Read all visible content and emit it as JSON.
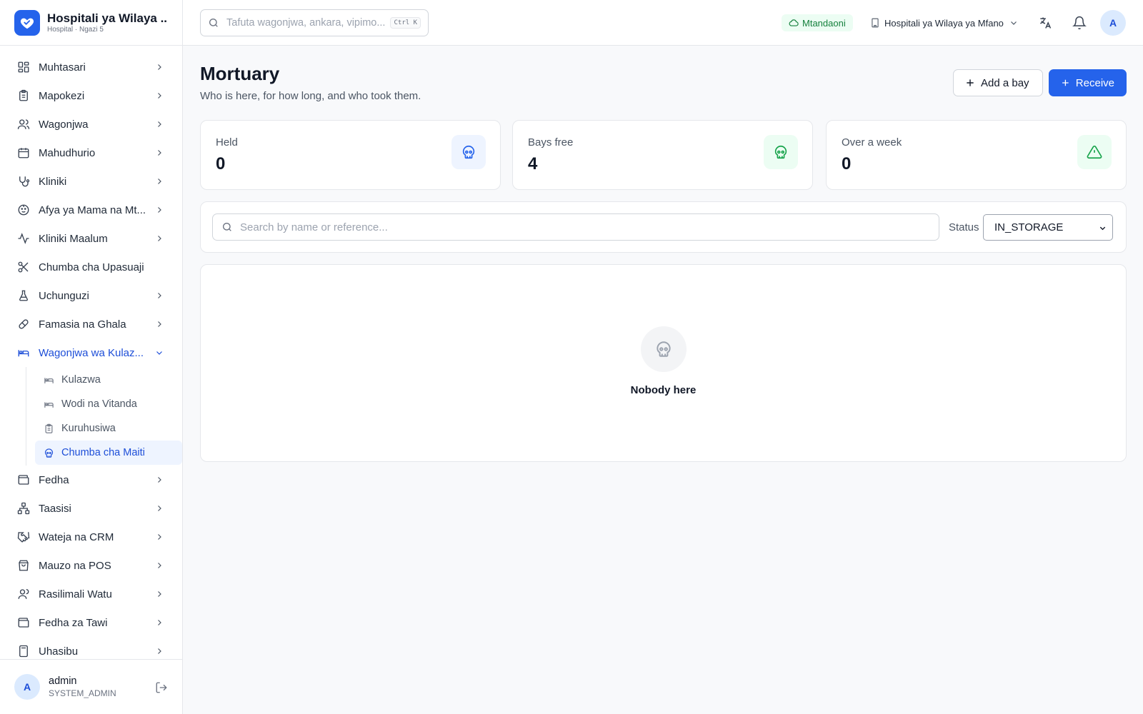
{
  "brand": {
    "name": "Hospitali ya Wilaya ...",
    "subtitle": "Hospital · Ngazi 5"
  },
  "sidebar": {
    "items": [
      {
        "label": "Muhtasari",
        "icon": "grid-icon"
      },
      {
        "label": "Mapokezi",
        "icon": "clipboard-icon"
      },
      {
        "label": "Wagonjwa",
        "icon": "users-icon"
      },
      {
        "label": "Mahudhurio",
        "icon": "calendar-icon"
      },
      {
        "label": "Kliniki",
        "icon": "stethoscope-icon"
      },
      {
        "label": "Afya ya Mama na Mt...",
        "icon": "baby-icon"
      },
      {
        "label": "Kliniki Maalum",
        "icon": "activity-icon"
      },
      {
        "label": "Chumba cha Upasuaji",
        "icon": "scissors-icon"
      },
      {
        "label": "Uchunguzi",
        "icon": "flask-icon"
      },
      {
        "label": "Famasia na Ghala",
        "icon": "pill-icon"
      },
      {
        "label": "Wagonjwa wa Kulaz...",
        "icon": "bed-icon"
      },
      {
        "label": "Fedha",
        "icon": "wallet-icon"
      },
      {
        "label": "Taasisi",
        "icon": "network-icon"
      },
      {
        "label": "Wateja na CRM",
        "icon": "handshake-icon"
      },
      {
        "label": "Mauzo na POS",
        "icon": "shopping-bag-icon"
      },
      {
        "label": "Rasilimali Watu",
        "icon": "user-icon"
      },
      {
        "label": "Fedha za Tawi",
        "icon": "wallet-icon"
      },
      {
        "label": "Uhasibu",
        "icon": "calculator-icon"
      }
    ],
    "subitems": [
      {
        "label": "Kulazwa",
        "icon": "bed-icon"
      },
      {
        "label": "Wodi na Vitanda",
        "icon": "bed-icon"
      },
      {
        "label": "Kuruhusiwa",
        "icon": "clipboard-icon"
      },
      {
        "label": "Chumba cha Maiti",
        "icon": "skull-icon"
      }
    ],
    "user": {
      "initial": "A",
      "name": "admin",
      "role": "SYSTEM_ADMIN"
    }
  },
  "topbar": {
    "search_placeholder": "Tafuta wagonjwa, ankara, vipimo...",
    "shortcut": "Ctrl K",
    "status": "Mtandaoni",
    "facility": "Hospitali ya Wilaya ya Mfano",
    "avatar_initial": "A"
  },
  "page": {
    "title": "Mortuary",
    "subtitle": "Who is here, for how long, and who took them.",
    "add_bay_label": "Add a bay",
    "receive_label": "Receive"
  },
  "stats": [
    {
      "label": "Held",
      "value": "0",
      "icon": "skull-icon",
      "color": "#2563eb",
      "bg": "#eef4ff"
    },
    {
      "label": "Bays free",
      "value": "4",
      "icon": "skull-icon",
      "color": "#16a34a",
      "bg": "#ecfdf3"
    },
    {
      "label": "Over a week",
      "value": "0",
      "icon": "alert-triangle-icon",
      "color": "#16a34a",
      "bg": "#ecfdf3"
    }
  ],
  "filters": {
    "search_placeholder": "Search by name or reference...",
    "status_label": "Status",
    "status_value": "IN_STORAGE"
  },
  "empty": {
    "text": "Nobody here"
  },
  "colors": {
    "accent": "#2563eb",
    "success": "#16a34a"
  }
}
